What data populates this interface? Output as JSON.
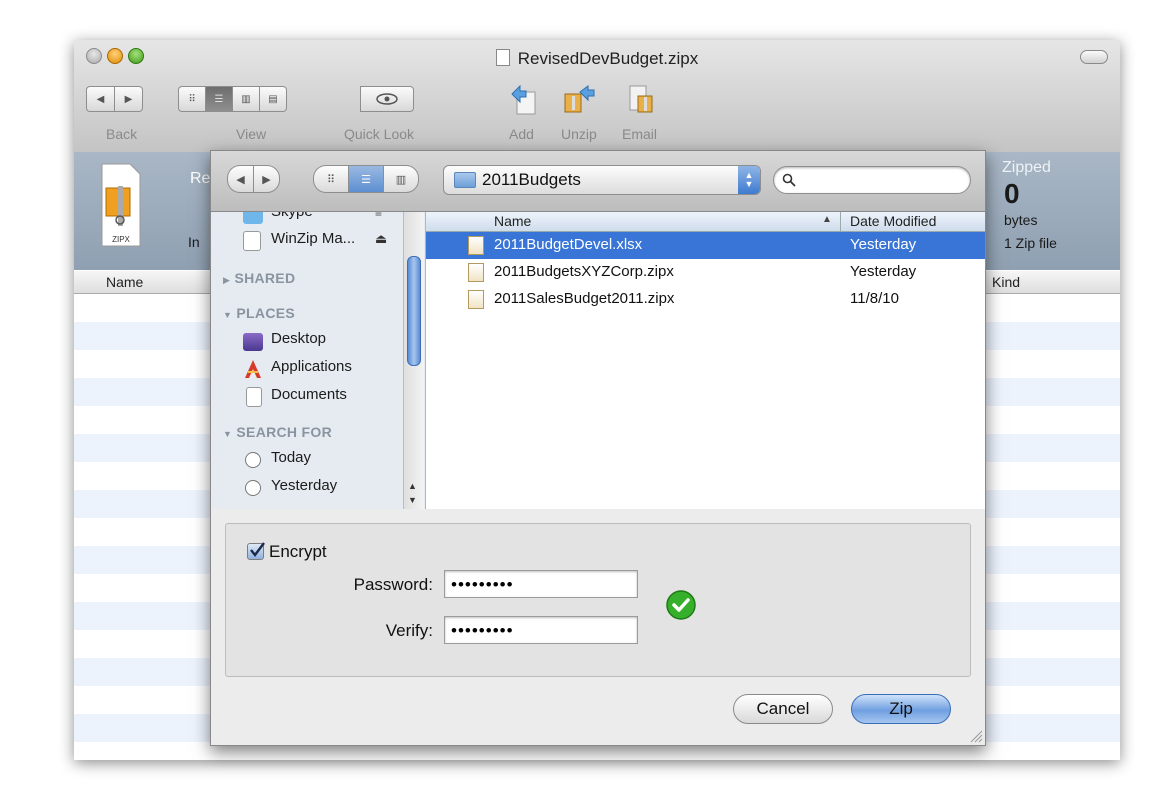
{
  "window": {
    "title": "RevisedDevBudget.zipx"
  },
  "toolbar": {
    "back_label": "Back",
    "view_label": "View",
    "quicklook_label": "Quick Look",
    "add_label": "Add",
    "unzip_label": "Unzip",
    "email_label": "Email"
  },
  "info": {
    "zipx_icon_text": "ZIPX",
    "name_fragment": "Re",
    "location_fragment": "In",
    "zipped_title": "Zipped",
    "zipped_value": "0",
    "zipped_unit": "bytes",
    "zipped_count": "1 Zip file"
  },
  "list_header": {
    "name": "Name",
    "kind": "Kind"
  },
  "dialog": {
    "folder": "2011Budgets",
    "search_value": "",
    "sidebar": {
      "items": [
        {
          "label": "Skype",
          "partial": true
        },
        {
          "label": "WinZip Ma..."
        }
      ],
      "sections": [
        {
          "title": "SHARED",
          "items": []
        },
        {
          "title": "PLACES",
          "items": [
            "Desktop",
            "Applications",
            "Documents"
          ]
        },
        {
          "title": "SEARCH FOR",
          "items": [
            "Today",
            "Yesterday"
          ]
        }
      ]
    },
    "file_list": {
      "headers": {
        "name": "Name",
        "date": "Date Modified"
      },
      "rows": [
        {
          "name": "2011BudgetDevel.xlsx",
          "date": "Yesterday",
          "selected": true
        },
        {
          "name": "2011BudgetsXYZCorp.zipx",
          "date": "Yesterday",
          "selected": false
        },
        {
          "name": "2011SalesBudget2011.zipx",
          "date": "11/8/10",
          "selected": false
        }
      ]
    },
    "encrypt": {
      "label": "Encrypt",
      "checked": true,
      "password_label": "Password:",
      "password_value": "•••••••••",
      "verify_label": "Verify:",
      "verify_value": "•••••••••"
    },
    "buttons": {
      "cancel": "Cancel",
      "zip": "Zip"
    }
  }
}
